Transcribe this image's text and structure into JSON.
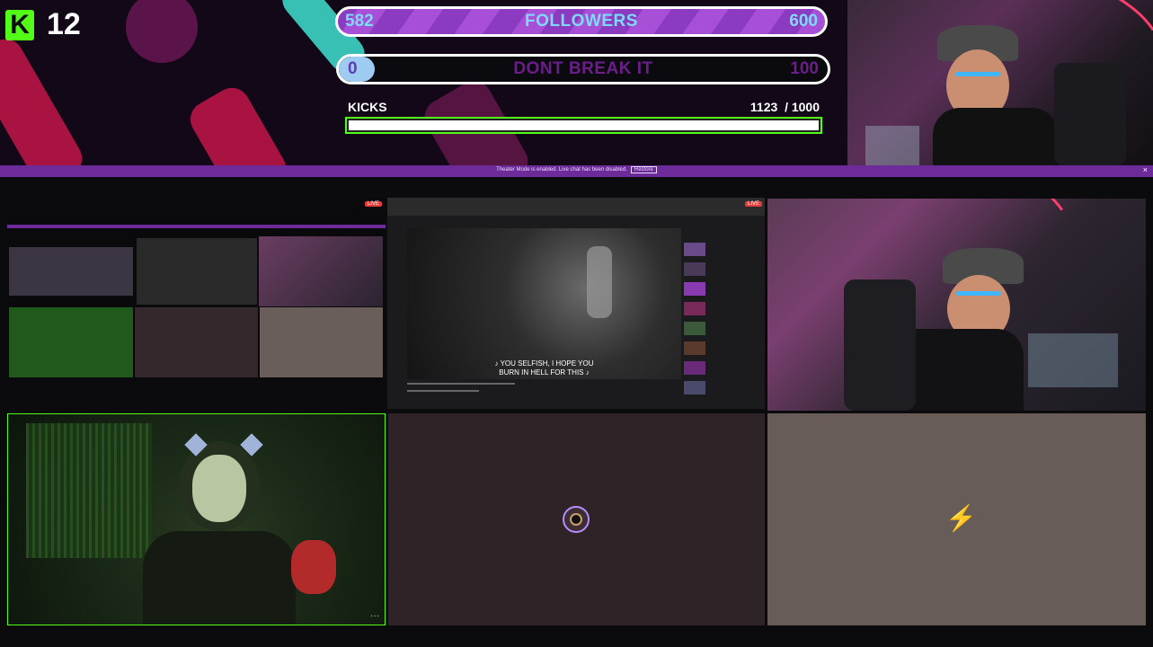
{
  "overlay": {
    "viewer_count": "12",
    "followers_goal": {
      "current": "582",
      "label": "FOLLOWERS",
      "target": "600",
      "progress": 0.97
    },
    "break_goal": {
      "current": "0",
      "label": "DONT BREAK IT",
      "target": "100",
      "progress": 0.0
    },
    "kicks": {
      "label": "KICKS",
      "current": "1123",
      "target": "/ 1000",
      "progress": 1.0
    }
  },
  "banner": {
    "message": "Theater Mode is enabled. Live chat has been disabled.",
    "button": "Restore",
    "close": "×"
  },
  "grid": {
    "top_left_live": "LIVE",
    "youtube_live": "LIVE",
    "youtube_subtitle_line1": "♪ YOU SELFISH, I HOPE YOU",
    "youtube_subtitle_line2": "BURN IN HELL FOR THIS ♪",
    "more_options": "···"
  },
  "colors": {
    "kick_green": "#53fc18",
    "goal_purple": "#a74fd6",
    "banner_purple": "#6d2a99",
    "goal_text_blue": "#7fd8ff"
  }
}
